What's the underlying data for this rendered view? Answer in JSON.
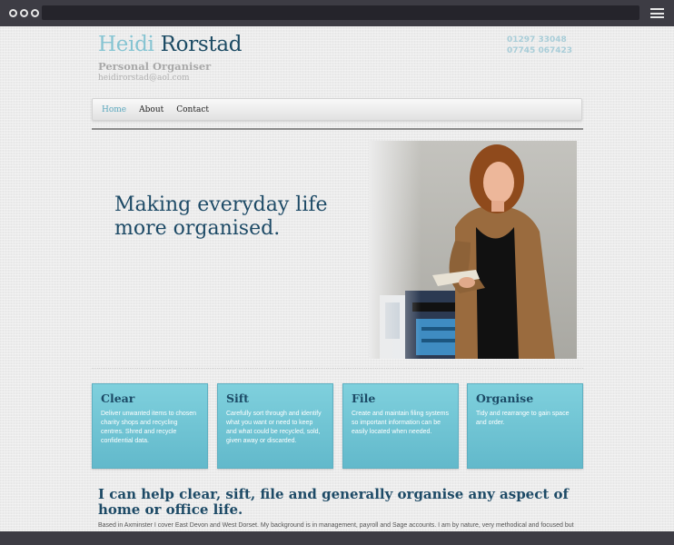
{
  "header": {
    "first_name": "Heidi",
    "last_name": "Rorstad",
    "subtitle": "Personal Organiser",
    "email": "heidirorstad@aol.com",
    "phone_1": "01297 33048",
    "phone_2": "07745 067423"
  },
  "nav": {
    "items": [
      {
        "label": "Home",
        "active": true
      },
      {
        "label": "About",
        "active": false
      },
      {
        "label": "Contact",
        "active": false
      }
    ]
  },
  "hero": {
    "heading": "Making everyday life more organised."
  },
  "cards": [
    {
      "title": "Clear",
      "text": "Deliver unwanted items to chosen charity shops and recycling centres. Shred and recycle confidential data."
    },
    {
      "title": "Sift",
      "text": "Carefully sort through and identify what you want or need to keep and what could be recycled, sold, given away or discarded."
    },
    {
      "title": "File",
      "text": "Create and maintain filing systems so important information can be easily located when needed."
    },
    {
      "title": "Organise",
      "text": "Tidy and rearrange to gain space and order."
    }
  ],
  "main": {
    "tagline": "I can help clear, sift, file and generally organise any aspect of home or office life.",
    "intro": "Based in Axminster I cover East Devon and West Dorset. My background is in management, payroll and Sage accounts. I am by nature, very methodical and focused but also"
  },
  "colors": {
    "accent_light": "#86c4d2",
    "accent_dark": "#1b4a63",
    "card_bg": "#72c5d5",
    "chrome": "#3d3c44"
  }
}
